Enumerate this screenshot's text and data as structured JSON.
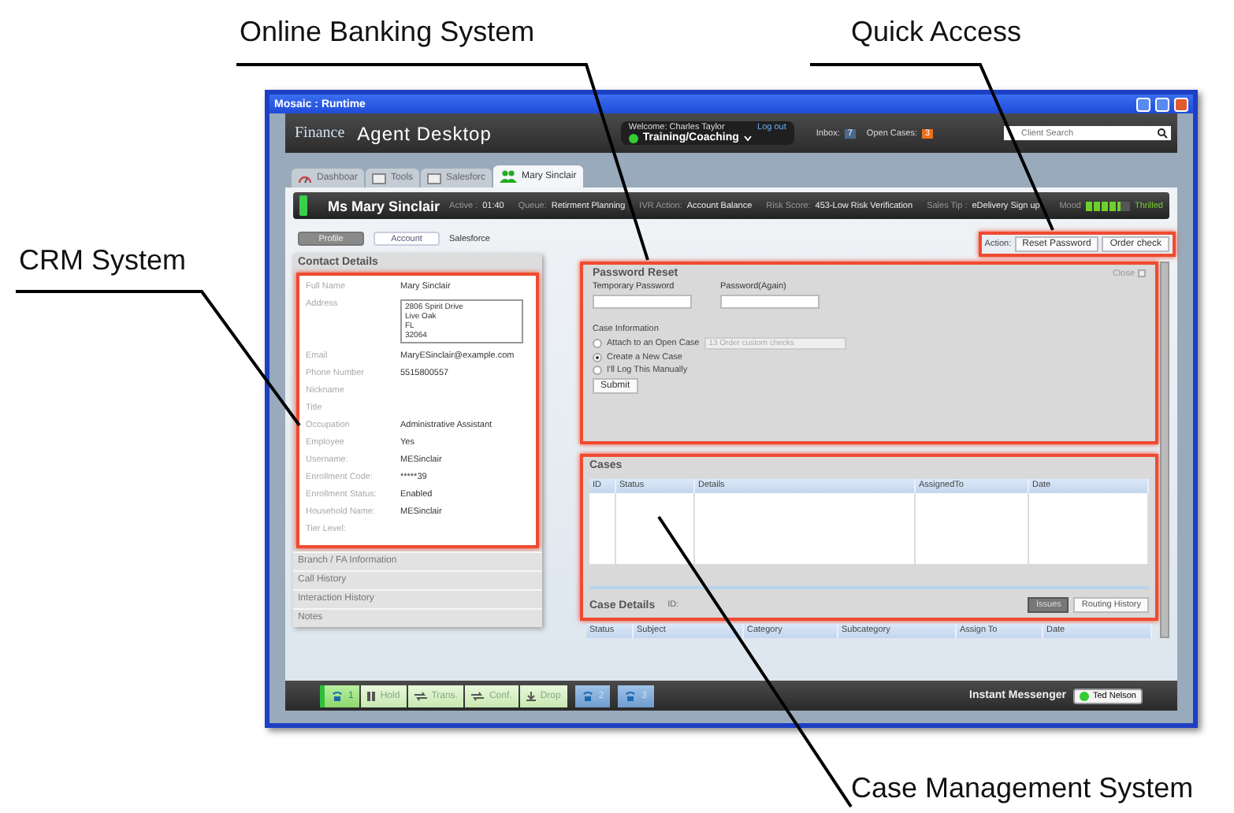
{
  "callouts": [
    {
      "label": "Online Banking System"
    },
    {
      "label": "Quick Access"
    },
    {
      "label": "CRM System"
    },
    {
      "label": "Case Management System"
    }
  ],
  "window": {
    "title": "Mosaic : Runtime"
  },
  "header": {
    "brand": "Finance",
    "app_name": "Agent Desktop",
    "welcome": "Welcome: Charles Taylor",
    "logout": "Log out",
    "status": "Training/Coaching",
    "inbox_label": "Inbox:",
    "inbox_count": "7",
    "open_cases_label": "Open Cases:",
    "open_cases_count": "3",
    "search_placeholder": "Client Search"
  },
  "tabs": [
    {
      "label": "Dashboar",
      "selected": false
    },
    {
      "label": "Tools",
      "selected": false
    },
    {
      "label": "Salesforc",
      "selected": false
    },
    {
      "label": "Mary Sinclair",
      "selected": true
    }
  ],
  "customer": {
    "name": "Ms Mary Sinclair",
    "fields": [
      {
        "label": "Active :",
        "value": "01:40"
      },
      {
        "label": "Queue:",
        "value": "Retirment Planning"
      },
      {
        "label": "IVR Action:",
        "value": "Account Balance"
      },
      {
        "label": "Risk Score:",
        "value": "453-Low Risk Verification"
      },
      {
        "label": "Sales Tip :",
        "value": "eDelivery Sign up"
      }
    ],
    "mood_label": "Mood",
    "mood": {
      "level": 0.8
    },
    "mood_value": "Thrilled"
  },
  "subtabs": [
    {
      "label": "Profile",
      "selected": true
    },
    {
      "label": "Account",
      "selected": false
    },
    {
      "label": "Salesforce",
      "selected": false
    }
  ],
  "contact_details": {
    "title": "Contact Details",
    "highlighted": true,
    "fields": [
      {
        "label": "Full Name",
        "value": "Mary Sinclair",
        "kind": "text"
      },
      {
        "label": "Address",
        "value": "2806 Spirit Drive\nLive Oak\nFL\n32064",
        "kind": "textarea"
      },
      {
        "label": "Email",
        "value": "MaryESinclair@example.com",
        "kind": "text"
      },
      {
        "label": "Phone Number",
        "value": "5515800557",
        "kind": "text"
      },
      {
        "label": "Nickname",
        "kind": "text"
      },
      {
        "label": "Title",
        "kind": "text"
      },
      {
        "label": "Occupation",
        "value": "Administrative Assistant",
        "kind": "text"
      },
      {
        "label": "Employee",
        "value": "Yes",
        "kind": "text"
      },
      {
        "label": "Username:",
        "value": "MESinclair",
        "kind": "text"
      },
      {
        "label": "Enrollment Code:",
        "value": "*****39",
        "kind": "text"
      },
      {
        "label": "Enrollment Status:",
        "value": "Enabled",
        "kind": "text"
      },
      {
        "label": "Household Name:",
        "value": "MESinclair",
        "kind": "text"
      },
      {
        "label": "Tier Level:",
        "kind": "text"
      }
    ],
    "sections": [
      "Branch / FA Information",
      "Call History",
      "Interaction History",
      "Notes"
    ]
  },
  "actions": {
    "label": "Action:",
    "highlighted": true,
    "buttons": [
      "Reset Password",
      "Order check"
    ]
  },
  "password_reset": {
    "title": "Password Reset",
    "close": "Close",
    "highlighted": true,
    "fields": [
      {
        "label": "Temporary Password"
      },
      {
        "label": "Password(Again)"
      }
    ],
    "case_info_label": "Case Information",
    "options": [
      {
        "label": "Attach to an Open Case",
        "selected": false
      },
      {
        "label": "Create a New Case",
        "selected": true
      },
      {
        "label": "I'll Log This Manually",
        "selected": false
      }
    ],
    "case_select": "13 Order custom checks",
    "submit": "Submit"
  },
  "cases": {
    "title": "Cases",
    "highlighted": true,
    "columns": [
      "ID",
      "Status",
      "Details",
      "AssignedTo",
      "Date"
    ]
  },
  "case_details": {
    "title": "Case Details",
    "id_label": "ID:",
    "buttons": [
      {
        "label": "Issues",
        "selected": true
      },
      {
        "label": "Routing History",
        "selected": false
      }
    ],
    "columns": [
      "Status",
      "Subject",
      "Category",
      "Subcategory",
      "Assign To",
      "Date"
    ]
  },
  "call_bar": {
    "buttons": [
      {
        "label": "1",
        "kind": "line",
        "active": true
      },
      {
        "label": "Hold",
        "kind": "hold",
        "active": true
      },
      {
        "label": "Trans.",
        "kind": "transfer",
        "active": true
      },
      {
        "label": "Conf.",
        "kind": "conference",
        "active": true
      },
      {
        "label": "Drop",
        "kind": "drop",
        "active": true
      },
      {
        "label": "2",
        "kind": "line",
        "active": false
      },
      {
        "label": "3",
        "kind": "line",
        "active": false
      }
    ]
  },
  "messenger": {
    "label": "Instant Messenger",
    "contact": "Ted Nelson"
  }
}
